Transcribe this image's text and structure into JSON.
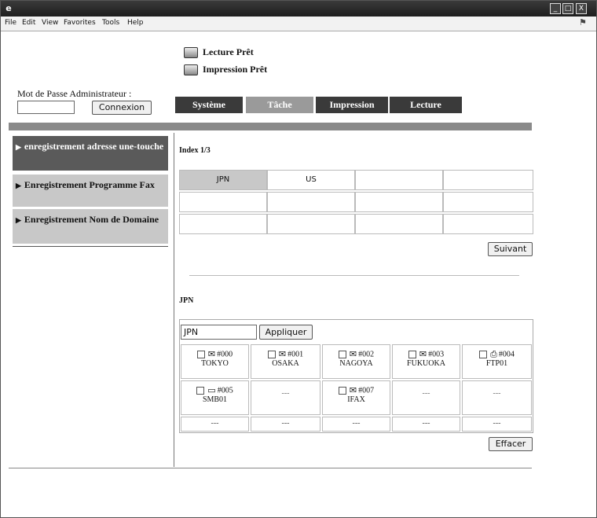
{
  "window": {
    "icon": "e-icon",
    "buttons": [
      "_",
      "□",
      "X"
    ]
  },
  "menu": [
    "File",
    "Edit",
    "View",
    "Favorites",
    "Tools",
    "Help"
  ],
  "status": {
    "lecture": "Lecture Prêt",
    "impression": "Impression Prêt"
  },
  "admin": {
    "label": "Mot de Passe Administrateur :",
    "login_button": "Connexion"
  },
  "tabs": [
    {
      "label": "Système",
      "bg": "#3a3a3a"
    },
    {
      "label": "Tâche",
      "bg": "#9a9a9a"
    },
    {
      "label": "Impression",
      "bg": "#3a3a3a"
    },
    {
      "label": "Lecture",
      "bg": "#3a3a3a"
    }
  ],
  "sidebar": [
    {
      "label": "enregistrement adresse une-touche",
      "marker": "▶",
      "bg": "#5a5a5a",
      "color": "#ffffff"
    },
    {
      "label": "Enregistrement Programme Fax",
      "marker": "▶",
      "bg": "#c8c8c8",
      "color": "#111111"
    },
    {
      "label": "Enregistrement Nom de Domaine",
      "marker": "▶",
      "bg": "#c8c8c8",
      "color": "#111111"
    }
  ],
  "index": {
    "label": "Index 1/3",
    "cells": [
      "JPN",
      "US",
      "",
      "",
      "",
      "",
      "",
      "",
      "",
      "",
      "",
      ""
    ],
    "next_button": "Suivant"
  },
  "section": {
    "label": "JPN",
    "filter_value": "JPN",
    "apply_button": "Appliquer",
    "clear_button": "Effacer"
  },
  "entries": [
    {
      "num": "#000",
      "name": "TOKYO",
      "icon": "✉"
    },
    {
      "num": "#001",
      "name": "OSAKA",
      "icon": "✉"
    },
    {
      "num": "#002",
      "name": "NAGOYA",
      "icon": "✉"
    },
    {
      "num": "#003",
      "name": "FUKUOKA",
      "icon": "✉"
    },
    {
      "num": "#004",
      "name": "FTP01",
      "icon": "⎙"
    },
    {
      "num": "#005",
      "name": "SMB01",
      "icon": "▭"
    },
    {
      "empty": "---"
    },
    {
      "num": "#007",
      "name": "IFAX",
      "icon": "✉"
    },
    {
      "empty": "---"
    },
    {
      "empty": "---"
    },
    {
      "empty": "---"
    },
    {
      "empty": "---"
    },
    {
      "empty": "---"
    },
    {
      "empty": "---"
    },
    {
      "empty": "---"
    }
  ]
}
